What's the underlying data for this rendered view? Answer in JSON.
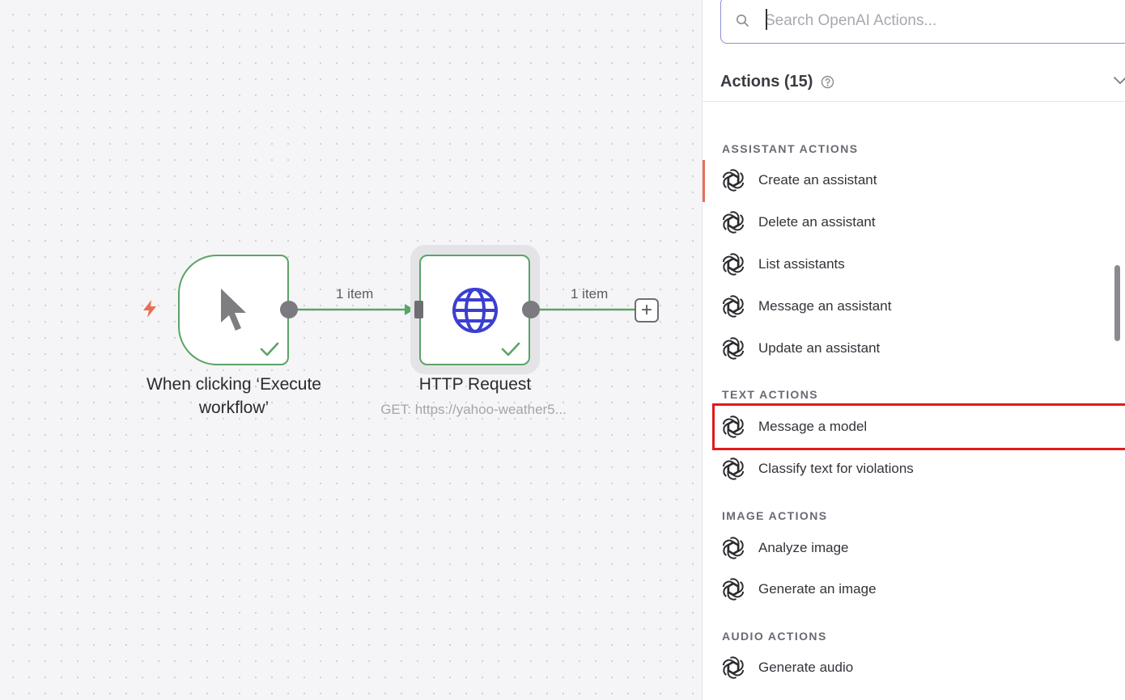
{
  "canvas": {
    "nodes": {
      "manual_trigger": {
        "title": "When clicking ‘Execute workflow’"
      },
      "http_request": {
        "title": "HTTP Request",
        "subtitle": "GET: https://yahoo-weather5..."
      }
    },
    "edges": [
      {
        "label": "1 item"
      },
      {
        "label": "1 item"
      }
    ],
    "add_button": "+"
  },
  "panel": {
    "search": {
      "placeholder": "Search OpenAI Actions...",
      "value": ""
    },
    "actions_title": "Actions (15)",
    "sections": [
      {
        "heading": "ASSISTANT ACTIONS",
        "items": [
          "Create an assistant",
          "Delete an assistant",
          "List assistants",
          "Message an assistant",
          "Update an assistant"
        ]
      },
      {
        "heading": "TEXT ACTIONS",
        "items": [
          "Message a model",
          "Classify text for violations"
        ]
      },
      {
        "heading": "IMAGE ACTIONS",
        "items": [
          "Analyze image",
          "Generate an image"
        ]
      },
      {
        "heading": "AUDIO ACTIONS",
        "items": [
          "Generate audio"
        ]
      }
    ]
  },
  "colors": {
    "success_green": "#5aa466",
    "trigger_orange": "#ea6e57",
    "globe_blue": "#3b3fd1",
    "highlight_red": "#e01b1b"
  },
  "icons": {
    "trigger": "lightning-bolt-icon",
    "manual": "mouse-pointer-icon",
    "http": "globe-icon",
    "status": "checkmark-icon",
    "search": "search-icon",
    "help": "help-circle-icon",
    "collapse": "chevron-down-icon",
    "openai": "openai-logo-icon"
  }
}
